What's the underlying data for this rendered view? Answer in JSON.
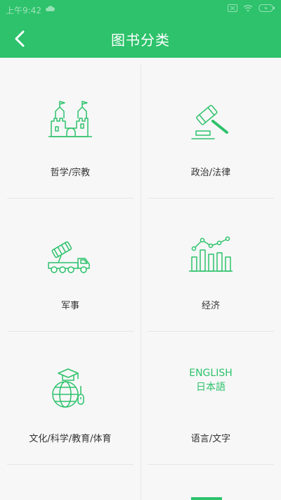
{
  "status_bar": {
    "time": "上午9:42"
  },
  "header": {
    "title": "图书分类"
  },
  "categories": [
    {
      "label": "哲学/宗教",
      "icon": "castle-icon"
    },
    {
      "label": "政治/法律",
      "icon": "gavel-icon"
    },
    {
      "label": "军事",
      "icon": "missile-truck-icon"
    },
    {
      "label": "经济",
      "icon": "bar-line-chart-icon"
    },
    {
      "label": "文化/科学/教育/体育",
      "icon": "globe-graduation-icon"
    },
    {
      "label": "语言/文字",
      "icon": "language-text-icon",
      "icon_text_1": "ENGLISH",
      "icon_text_2": "日本語"
    }
  ],
  "colors": {
    "accent": "#2dc26b",
    "background": "#f7f7f7",
    "divider": "#e6e6e6",
    "text": "#333333"
  }
}
